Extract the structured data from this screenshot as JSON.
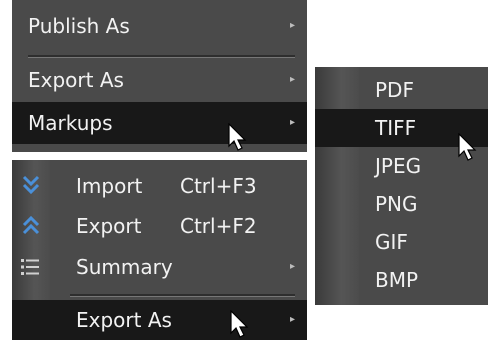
{
  "top_menu": {
    "items": [
      {
        "label": "Publish As"
      },
      {
        "label": "Export As"
      },
      {
        "label": "Markups"
      }
    ]
  },
  "bottom_menu": {
    "items": [
      {
        "label": "Import",
        "shortcut": "Ctrl+F3",
        "icon": "double-chevron-down-icon"
      },
      {
        "label": "Export",
        "shortcut": "Ctrl+F2",
        "icon": "double-chevron-up-icon"
      },
      {
        "label": "Summary",
        "icon": "list-icon"
      },
      {
        "label": "Export As"
      }
    ]
  },
  "submenu": {
    "items": [
      {
        "label": "PDF"
      },
      {
        "label": "TIFF"
      },
      {
        "label": "JPEG"
      },
      {
        "label": "PNG"
      },
      {
        "label": "GIF"
      },
      {
        "label": "BMP"
      }
    ]
  },
  "colors": {
    "menu_bg": "#4a4a4a",
    "highlight_bg": "#181818",
    "text": "#f2f2f2",
    "icon_blue": "#4a90d9"
  }
}
